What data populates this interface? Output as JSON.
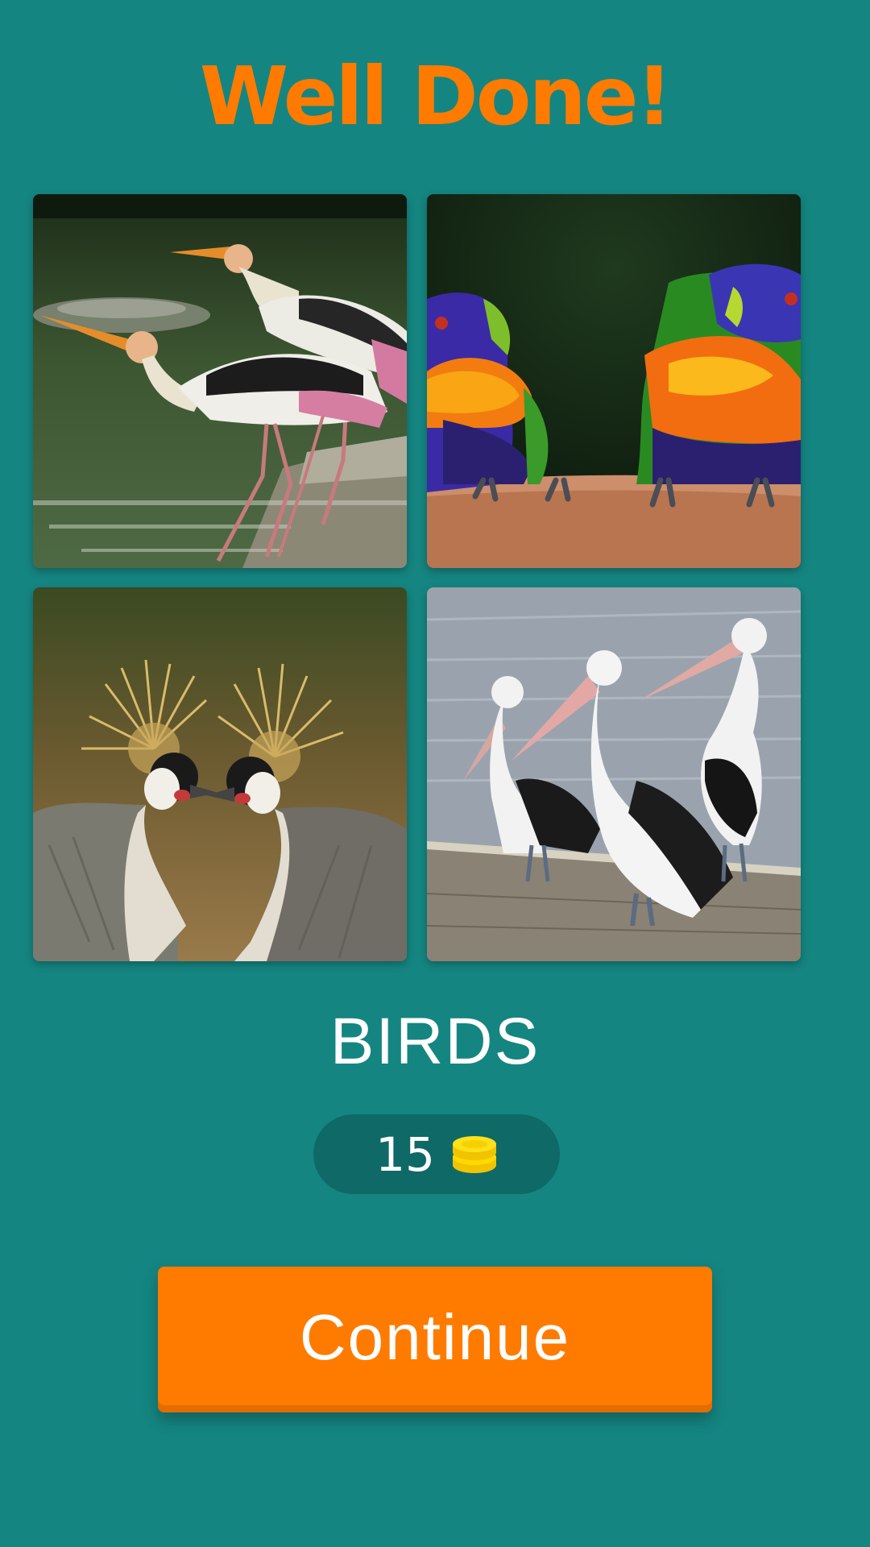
{
  "title": "Well Done!",
  "images": [
    {
      "subject": "painted storks wading in water"
    },
    {
      "subject": "two rainbow lorikeets on a clay dish"
    },
    {
      "subject": "two grey crowned cranes"
    },
    {
      "subject": "three pelicans on a wooden jetty"
    }
  ],
  "answer": "BIRDS",
  "reward": {
    "value": "15",
    "icon": "coin-stack-icon"
  },
  "continue_label": "Continue",
  "colors": {
    "background": "#158581",
    "title": "#fe7b00",
    "button": "#fe7b00",
    "reward_pill": "#0e6967",
    "coin": "#f7d000"
  }
}
